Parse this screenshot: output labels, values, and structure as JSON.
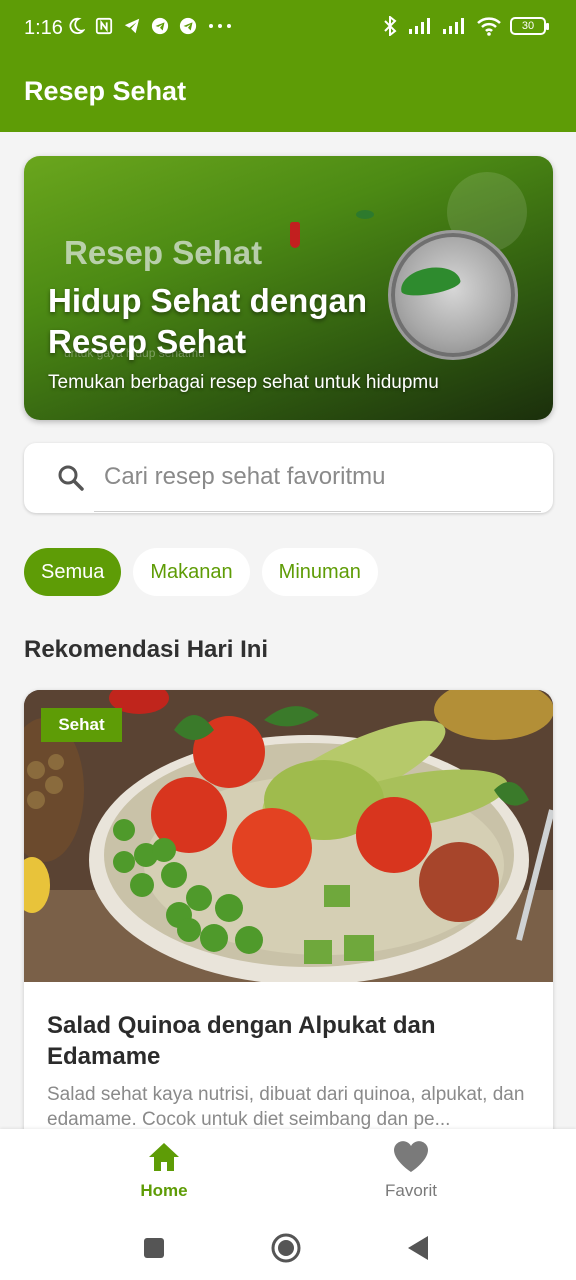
{
  "status_bar": {
    "time": "1:16",
    "battery": "30",
    "icons_left": [
      "moon-icon",
      "nfc-icon",
      "telegram-icon",
      "telegram-icon",
      "telegram-icon",
      "more-icon"
    ],
    "icons_right": [
      "bluetooth-icon",
      "signal-icon",
      "signal-icon",
      "wifi-icon",
      "battery-icon"
    ]
  },
  "app_bar": {
    "title": "Resep Sehat"
  },
  "hero": {
    "ghost_title": "Resep Sehat",
    "ghost_subtitle": "untuk gaya hidup sehatmu",
    "title": "Hidup Sehat dengan Resep Sehat",
    "subtitle": "Temukan berbagai resep sehat untuk hidupmu"
  },
  "search": {
    "placeholder": "Cari resep sehat favoritmu",
    "value": ""
  },
  "filters": [
    {
      "label": "Semua",
      "active": true
    },
    {
      "label": "Makanan",
      "active": false
    },
    {
      "label": "Minuman",
      "active": false
    }
  ],
  "section_title": "Rekomendasi Hari Ini",
  "recipe": {
    "badge": "Sehat",
    "title": "Salad Quinoa dengan Alpukat dan Edamame",
    "description": "Salad sehat kaya nutrisi, dibuat dari quinoa, alpukat, dan edamame. Cocok untuk diet seimbang dan pe..."
  },
  "bottom_nav": [
    {
      "label": "Home",
      "icon": "home-icon",
      "active": true
    },
    {
      "label": "Favorit",
      "icon": "heart-icon",
      "active": false
    }
  ],
  "colors": {
    "primary": "#5e9c06",
    "background": "#f4f4f4",
    "inactive": "#7a7a7a"
  }
}
